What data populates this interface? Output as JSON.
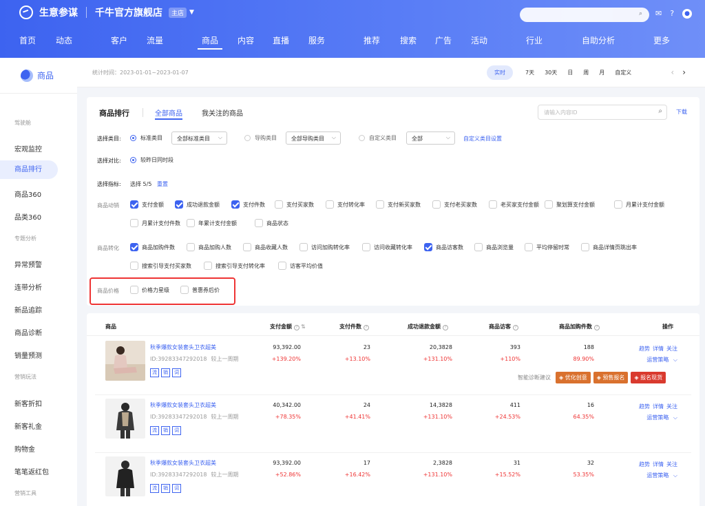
{
  "brand": {
    "name": "生意参谋",
    "shop": "千牛官方旗舰店",
    "shop_badge": "主店"
  },
  "nav": [
    "首页",
    "动态",
    "客户",
    "流量",
    "商品",
    "内容",
    "直播",
    "服务",
    "推荐",
    "搜索",
    "广告",
    "活动",
    "行业",
    "自助分析",
    "更多"
  ],
  "nav_active": "商品",
  "sidebar": {
    "title": "商品",
    "sections": [
      {
        "category": "驾驶舱",
        "items": [
          "宏观监控",
          "商品排行",
          "商品360",
          "品类360"
        ]
      },
      {
        "category": "专题分析",
        "items": [
          "异常预警",
          "连带分析",
          "新品追踪",
          "商品诊断",
          "销量预测"
        ]
      },
      {
        "category": "营销玩法",
        "items": [
          "新客折扣",
          "新客礼金",
          "购物金",
          "笔笔返红包"
        ]
      },
      {
        "category": "营销工具",
        "items": []
      }
    ],
    "active_item": "商品排行"
  },
  "date_bar": {
    "stat_time": "统计时间：2023-01-01~2023-01-07",
    "tabs": [
      "实时",
      "7天",
      "30天",
      "日",
      "周",
      "月",
      "自定义"
    ],
    "active_tab": "实时"
  },
  "filter_panel": {
    "title": "商品排行",
    "tabs": [
      "全部商品",
      "我关注的商品"
    ],
    "search_placeholder": "请输入内容ID",
    "download": "下载",
    "category_label": "选择类目:",
    "category_options": [
      {
        "label": "标准类目",
        "selected": true,
        "select_value": "全部标准类目"
      },
      {
        "label": "导购类目",
        "selected": false,
        "select_value": "全部导购类目"
      },
      {
        "label": "自定义类目",
        "selected": false,
        "select_value": "全部"
      }
    ],
    "custom_category_link": "自定义类目设置",
    "compare_label": "选择对比:",
    "compare_option": "较昨日同时段",
    "indicator_label": "选择指标:",
    "indicator_text": "选择 5/5",
    "reset": "重置",
    "groups": [
      {
        "name": "商品动销",
        "items": [
          {
            "label": "支付金额",
            "checked": true
          },
          {
            "label": "成功退款金额",
            "checked": true
          },
          {
            "label": "支付件数",
            "checked": true
          },
          {
            "label": "支付买家数",
            "checked": false
          },
          {
            "label": "支付转化率",
            "checked": false
          },
          {
            "label": "支付新买家数",
            "checked": false
          },
          {
            "label": "支付老买家数",
            "checked": false
          },
          {
            "label": "老买家支付金额",
            "checked": false
          },
          {
            "label": "聚划算支付金额",
            "checked": false
          },
          {
            "label": "月累计支付金额",
            "checked": false
          },
          {
            "label": "月累计支付件数",
            "checked": false
          },
          {
            "label": "年累计支付金额",
            "checked": false
          },
          {
            "label": "商品状态",
            "checked": false
          }
        ]
      },
      {
        "name": "商品转化",
        "items": [
          {
            "label": "商品加购件数",
            "checked": true
          },
          {
            "label": "商品加购人数",
            "checked": false
          },
          {
            "label": "商品收藏人数",
            "checked": false
          },
          {
            "label": "访问加购转化率",
            "checked": false
          },
          {
            "label": "访问收藏转化率",
            "checked": false
          },
          {
            "label": "商品访客数",
            "checked": true
          },
          {
            "label": "商品浏览量",
            "checked": false
          },
          {
            "label": "平均停留时常",
            "checked": false
          },
          {
            "label": "商品详情页跳出率",
            "checked": false
          },
          {
            "label": "搜索引导支付买家数",
            "checked": false
          },
          {
            "label": "搜索引导支付转化率",
            "checked": false
          },
          {
            "label": "访客平均价值",
            "checked": false
          }
        ]
      },
      {
        "name": "商品价格",
        "items": [
          {
            "label": "价格力星级",
            "checked": false
          },
          {
            "label": "普惠券后价",
            "checked": false
          }
        ]
      }
    ]
  },
  "table": {
    "headers": [
      "商品",
      "支付金额",
      "支付件数",
      "成功退款金额",
      "商品访客",
      "商品加购件数",
      "操作"
    ],
    "rows": [
      {
        "title": "秋季爆款女装套头卫衣超美",
        "id": "ID:39283347292018",
        "compare": "较上一周期",
        "tags": [
          "流",
          "销",
          "词"
        ],
        "values": [
          "93,392.00",
          "23",
          "20,3828",
          "393",
          "188"
        ],
        "changes": [
          "+139.20%",
          "+13.10%",
          "+131.10%",
          "+110%",
          "89.90%"
        ],
        "actions": [
          "趋势",
          "详情",
          "关注"
        ],
        "strategy": "运营策略",
        "advice_label": "智能诊断建议",
        "advice": [
          "优化创意",
          "预售报名",
          "报名现货"
        ]
      },
      {
        "title": "秋季爆款女装套头卫衣超美",
        "id": "ID:39283347292018",
        "compare": "较上一周期",
        "tags": [
          "流",
          "销",
          "词"
        ],
        "values": [
          "40,342.00",
          "24",
          "14,3828",
          "411",
          "16"
        ],
        "changes": [
          "+78.35%",
          "+41.41%",
          "+131.10%",
          "+24.53%",
          "64.35%"
        ],
        "actions": [
          "趋势",
          "详情",
          "关注"
        ],
        "strategy": "运营策略"
      },
      {
        "title": "秋季爆款女装套头卫衣超美",
        "id": "ID:39283347292018",
        "compare": "较上一周期",
        "tags": [
          "流",
          "销",
          "词"
        ],
        "values": [
          "93,392.00",
          "17",
          "2,3828",
          "31",
          "32"
        ],
        "changes": [
          "+52.86%",
          "+16.42%",
          "+131.10%",
          "+15.52%",
          "53.35%"
        ],
        "actions": [
          "趋势",
          "详情",
          "关注"
        ],
        "strategy": "运营策略"
      }
    ]
  }
}
